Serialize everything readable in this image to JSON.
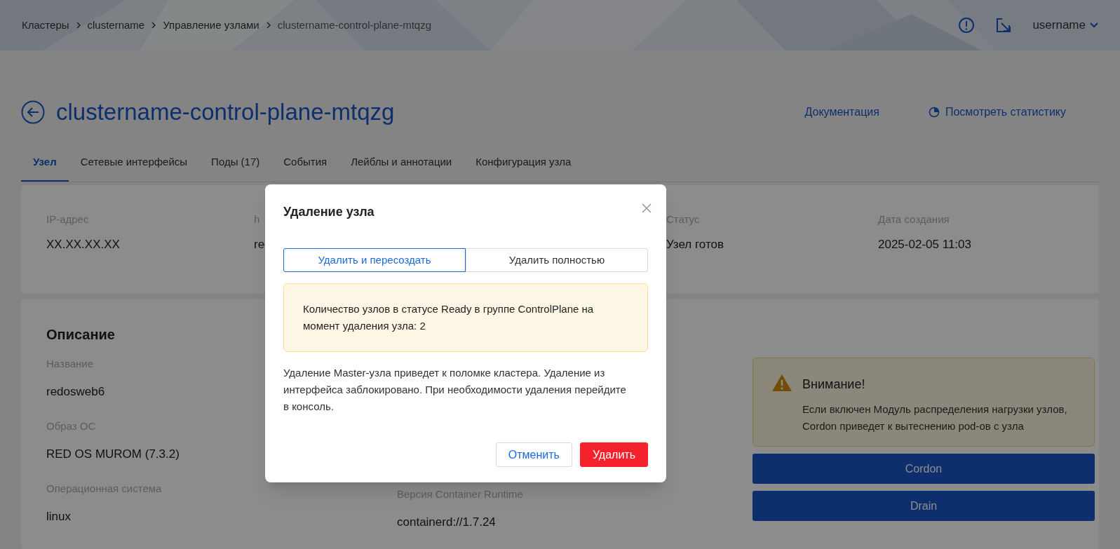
{
  "breadcrumbs": [
    "Кластеры",
    "clustername",
    "Управление узлами",
    "clustername-control-plane-mtqzg"
  ],
  "user": {
    "name": "username"
  },
  "page": {
    "title": "clustername-control-plane-mtqzg",
    "links": [
      {
        "kind": "plain",
        "label": "Документация"
      },
      {
        "kind": "stats",
        "label": "Посмотреть статистику"
      }
    ]
  },
  "tabs": [
    {
      "label": "Узел",
      "selected": true
    },
    {
      "label": "Сетевые интерфейсы",
      "selected": false
    },
    {
      "label": "Поды (17)",
      "selected": false
    },
    {
      "label": "События",
      "selected": false
    },
    {
      "label": "Лейблы и аннотации",
      "selected": false
    },
    {
      "label": "Конфигурация узла",
      "selected": false
    }
  ],
  "summary": [
    {
      "label": "IP-адрес",
      "value": "XX.XX.XX.XX"
    },
    {
      "label": "h",
      "value": "re"
    },
    {
      "label": "Статус",
      "value": "Узел готов"
    },
    {
      "label": "Дата создания",
      "value": "2025-02-05 11:03"
    }
  ],
  "description": {
    "title": "Описание",
    "left": [
      {
        "label": "Название",
        "value": "redosweb6"
      },
      {
        "label": "Образ ОС",
        "value": "RED OS MUROM (7.3.2)"
      },
      {
        "label": "Операционная система",
        "value": "linux"
      }
    ],
    "right": [
      {
        "label": "Версия Container Runtime",
        "value": "containerd://1.7.24"
      }
    ]
  },
  "warning": {
    "title": "Внимание!",
    "text": "Если включен Модуль распределения нагрузки узлов, Cordon приведет к вытеснению pod-ов с узла"
  },
  "actions": [
    "Cordon",
    "Drain"
  ],
  "dialog": {
    "title": "Удаление узла",
    "modes": [
      {
        "label": "Удалить и пересоздать",
        "selected": true
      },
      {
        "label": "Удалить полностью",
        "selected": false
      }
    ],
    "notice": "Количество узлов в статусе Ready в группе ControlPlane на момент удаления узла: 2",
    "message": "Удаление Master-узла приведет к поломке кластера. Удаление из интерфейса заблокировано. При необходимости удаления перейдите в консоль.",
    "buttons": [
      {
        "kind": "secondary",
        "label": "Отменить"
      },
      {
        "kind": "danger",
        "label": "Удалить"
      }
    ]
  }
}
